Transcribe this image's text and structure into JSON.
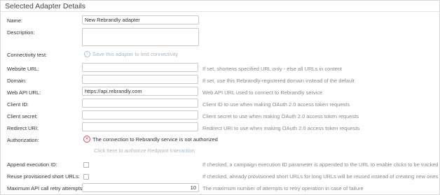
{
  "section_title": "Selected Adapter Details",
  "fields": {
    "name": {
      "label": "Name:",
      "value": "New Rebrandly adapter"
    },
    "description": {
      "label": "Description:"
    },
    "connectivity": {
      "label": "Connectivity test:",
      "action": "Save this adapter to test connectivity",
      "icon": "info-icon"
    },
    "website_url": {
      "label": "Website URL:",
      "value": "",
      "help": "If set, shortens specified URL only - else all URLs in content"
    },
    "domain": {
      "label": "Domain:",
      "value": "",
      "help": "If set, use this Rebrandly-registered domain instead of the default"
    },
    "web_api_url": {
      "label": "Web API URL:",
      "value": "https://api.rebrandly.com",
      "help": "Web API URL used to connect to Rebrandly service"
    },
    "client_id": {
      "label": "Client ID:",
      "value": "",
      "help": "Client ID to use when making OAuth 2.0 access token requests"
    },
    "client_secret": {
      "label": "Client secret:",
      "value": "",
      "help": "Client secret to use when making OAuth 2.0 access token requests"
    },
    "redirect_uri": {
      "label": "Redirect URI:",
      "value": "",
      "help": "Redirect URI to use when making OAuth 2.0 access token requests"
    },
    "authorization": {
      "label": "Authorization:",
      "status": "The connection to Rebrandly service is not authorized",
      "link": "Click here to authorize Redpoint Interaction",
      "icon": "error-circle-icon",
      "status_color": "#d84a4a"
    },
    "append_execution_id": {
      "label": "Append execution ID:",
      "checked": false,
      "help": "If checked, a campaign execution ID parameter is appended to the URL to enable clicks to be tracked to the..."
    },
    "reuse_short_urls": {
      "label": "Reuse provisioned short URLs:",
      "checked": false,
      "help": "If checked, already provisioned short URLs for long URLs will be reused instead of creating new ones"
    },
    "max_retry": {
      "label": "Maximum API call retry attempts:",
      "value": "10",
      "help": "The maximum number of attempts to retry operation in case of failure"
    }
  }
}
